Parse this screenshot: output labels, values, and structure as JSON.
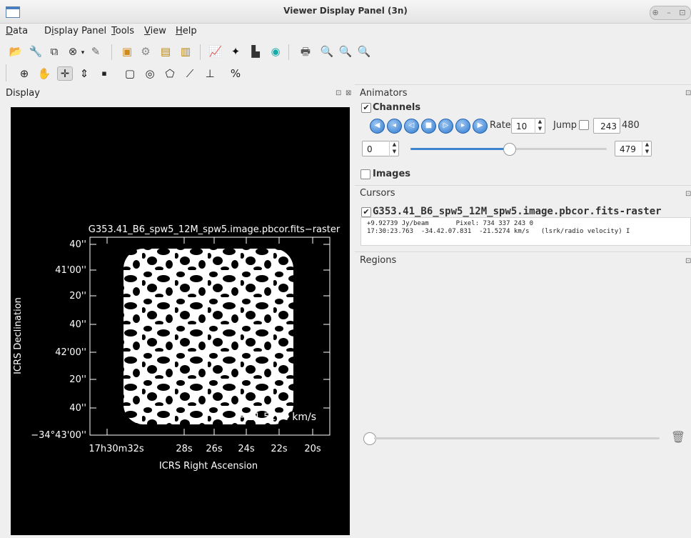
{
  "window": {
    "title": "Viewer Display Panel (3n)",
    "controls": "⊕ – ⊡"
  },
  "menu": [
    {
      "pre": "",
      "u": "D",
      "post": "ata"
    },
    {
      "pre": "D",
      "u": "i",
      "post": "splay Panel"
    },
    {
      "pre": "",
      "u": "T",
      "post": "ools"
    },
    {
      "pre": "",
      "u": "V",
      "post": "iew"
    },
    {
      "pre": "",
      "u": "H",
      "post": "elp"
    }
  ],
  "display": {
    "label": "Display"
  },
  "image": {
    "title": "G353.41_B6_spw5_12M_spw5.image.pbcor.fits−raster",
    "velocity_label": "−21.5274 km/s",
    "y_axis_label": "ICRS Declination",
    "x_axis_label": "ICRS Right Ascension",
    "y_ticks": [
      "40''",
      "41'00''",
      "20''",
      "40''",
      "42'00''",
      "20''",
      "40''",
      "−34°43'00''"
    ],
    "x_ticks": [
      "17h30m32s",
      "28s",
      "26s",
      "24s",
      "22s",
      "20s"
    ]
  },
  "animators": {
    "title": "Animators",
    "channels_label": "Channels",
    "rate_label": "Rate:",
    "rate_value": "10",
    "jump_label": "Jump",
    "jump_value": "243",
    "total": "480",
    "min_value": "0",
    "max_value": "479",
    "images_label": "Images",
    "slider_fraction": 0.5
  },
  "cursors": {
    "title": "Cursors",
    "image_name": "G353.41_B6_spw5_12M_spw5.image.pbcor.fits-raster",
    "line1": "+9.92739 Jy/beam       Pixel: 734 337 243 0",
    "line2": "17:30:23.763  -34.42.07.831  -21.5274 km/s   (lsrk/radio velocity) I"
  },
  "regions": {
    "title": "Regions"
  },
  "colors": {
    "accent": "#3d84cf",
    "canvas": "#000000"
  }
}
